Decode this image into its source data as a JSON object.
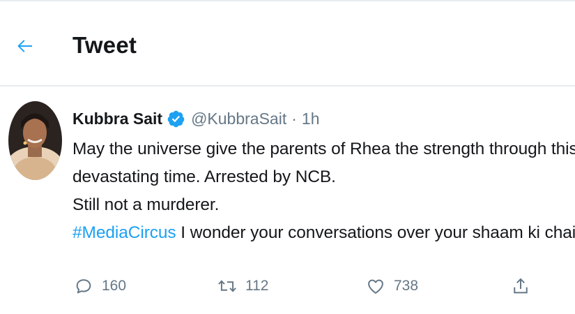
{
  "header": {
    "back_icon": "arrow-left-icon",
    "title": "Tweet"
  },
  "tweet": {
    "author_name": "Kubbra Sait",
    "verified_icon": "verified-badge-icon",
    "handle": "@KubbraSait",
    "separator": "·",
    "time": "1h",
    "lines": [
      "May the universe give the parents of Rhea the strength through this",
      "devastating time. Arrested by NCB.",
      "Still not a murderer."
    ],
    "hashtag": "#MediaCircus",
    "last_line_rest": " I wonder your conversations over your shaam ki chai."
  },
  "actions": {
    "reply_count": "160",
    "retweet_count": "112",
    "like_count": "738"
  },
  "colors": {
    "accent": "#1da1f2",
    "text": "#14171a",
    "secondary": "#657786",
    "divider": "#e6ecf0"
  }
}
